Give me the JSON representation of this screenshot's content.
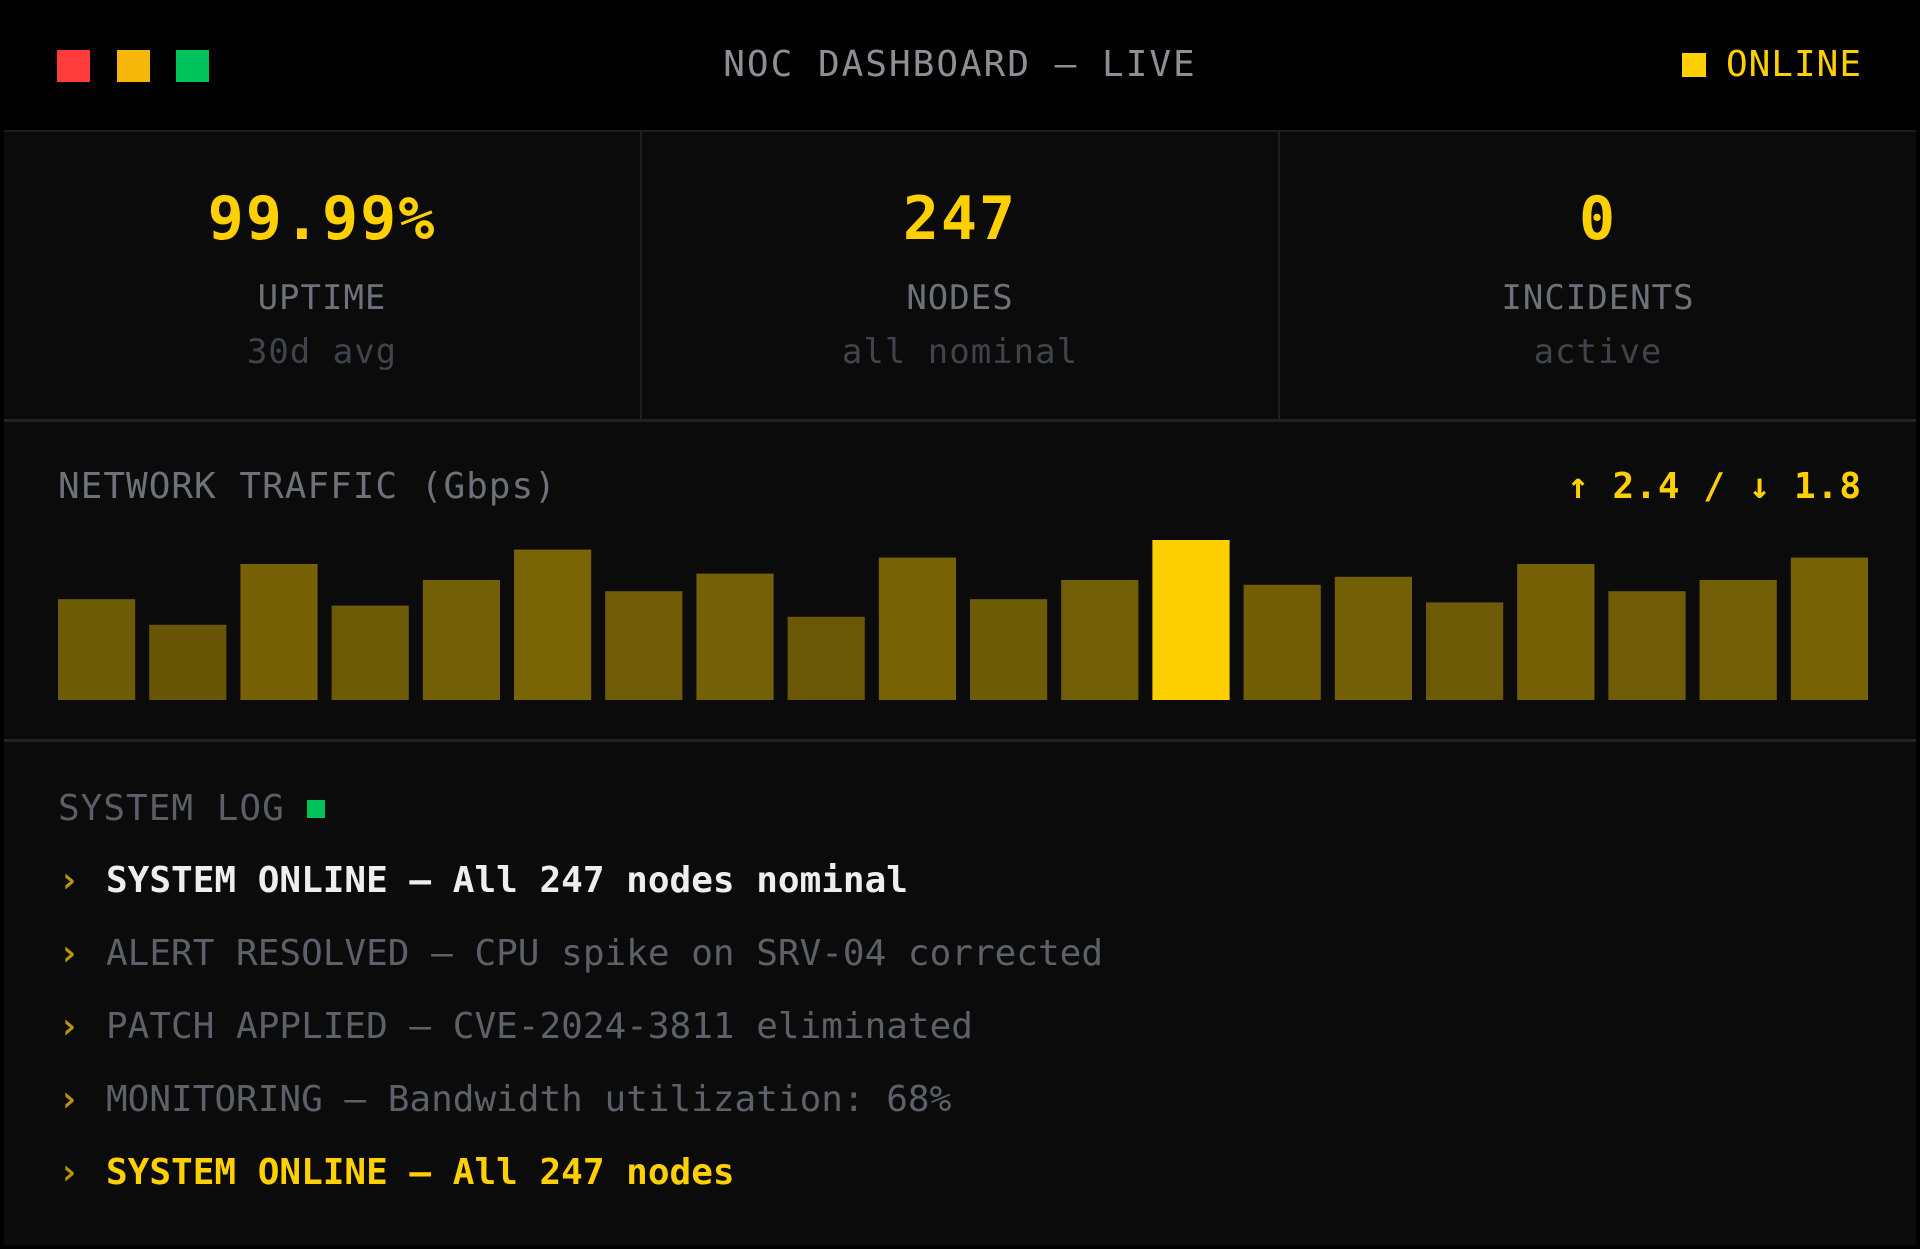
{
  "colors": {
    "accent": "#ffd000",
    "accent_dim": "#b8950a",
    "red": "#ff3b3b",
    "yellow": "#f5b70a",
    "green": "#00c25a"
  },
  "window": {
    "title": "NOC DASHBOARD — LIVE",
    "status_label": "ONLINE",
    "controls": [
      "close",
      "minimize",
      "maximize"
    ]
  },
  "stats": [
    {
      "value": "99.99%",
      "label": "UPTIME",
      "sub": "30d avg"
    },
    {
      "value": "247",
      "label": "NODES",
      "sub": "all nominal"
    },
    {
      "value": "0",
      "label": "INCIDENTS",
      "sub": "active"
    }
  ],
  "traffic": {
    "title": "NETWORK TRAFFIC (Gbps)",
    "up_arrow": "↑",
    "down_arrow": "↓",
    "up_value": "2.4",
    "separator": "/",
    "down_value": "1.8"
  },
  "chart_data": {
    "type": "bar",
    "highlight_index": 12,
    "values": [
      0.63,
      0.47,
      0.85,
      0.59,
      0.75,
      0.94,
      0.68,
      0.79,
      0.52,
      0.89,
      0.63,
      0.75,
      1.0,
      0.72,
      0.77,
      0.61,
      0.85,
      0.68,
      0.75,
      0.89
    ]
  },
  "log": {
    "title": "SYSTEM LOG",
    "prompt": "›",
    "entries": [
      {
        "text": "SYSTEM ONLINE — All 247 nodes nominal",
        "style": "primary"
      },
      {
        "text": "ALERT RESOLVED — CPU spike on SRV-04 corrected",
        "style": "muted"
      },
      {
        "text": "PATCH APPLIED — CVE-2024-3811 eliminated",
        "style": "muted"
      },
      {
        "text": "MONITORING — Bandwidth utilization: 68%",
        "style": "muted"
      },
      {
        "text": "SYSTEM ONLINE — All 247 nodes",
        "style": "active"
      }
    ]
  }
}
